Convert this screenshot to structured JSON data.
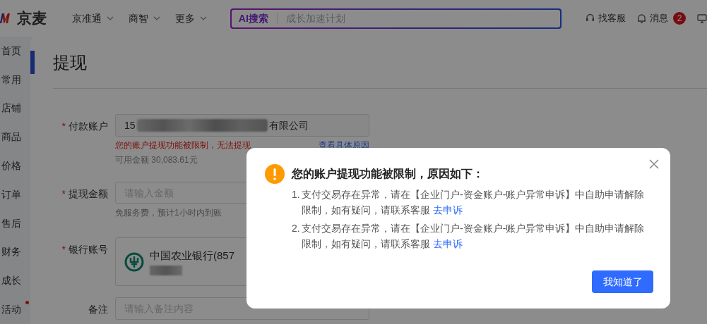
{
  "header": {
    "logo_text": "京麦",
    "nav": [
      {
        "label": "京准通"
      },
      {
        "label": "商智"
      },
      {
        "label": "更多"
      }
    ],
    "search": {
      "ai_label": "AI搜索",
      "placeholder": "成长加速计划"
    },
    "actions": [
      {
        "kind": "support",
        "label": "找客服"
      },
      {
        "kind": "messages",
        "label": "消息",
        "badge": "2"
      },
      {
        "kind": "screen"
      }
    ]
  },
  "sidebar": {
    "items": [
      {
        "label": "首页",
        "dot": false
      },
      {
        "label": "常用",
        "dot": false
      },
      {
        "label": "店铺",
        "dot": false
      },
      {
        "label": "商品",
        "dot": false
      },
      {
        "label": "价格",
        "dot": false
      },
      {
        "label": "订单",
        "dot": false
      },
      {
        "label": "售后",
        "dot": false
      },
      {
        "label": "财务",
        "dot": false
      },
      {
        "label": "成长",
        "dot": false
      },
      {
        "label": "活动",
        "dot": true
      }
    ]
  },
  "page": {
    "title": "提现"
  },
  "form": {
    "fields": [
      {
        "kind": "account",
        "label": "付款账户",
        "required_mark": "*",
        "value_start": "15",
        "value_end": "有限公司",
        "error": "您的账户提现功能被限制，无法提现",
        "link": "查看具体原因",
        "hint": "可用金额 30,083.61元"
      },
      {
        "kind": "input",
        "label": "提现金额",
        "required_mark": "*",
        "placeholder": "请输入金额",
        "hint": "免服务费，预计1小时内到账"
      },
      {
        "kind": "bank",
        "label": "银行账号",
        "required_mark": "*",
        "bank_name": "中国农业银行(857"
      },
      {
        "kind": "textarea",
        "label": "备注",
        "placeholder": "请输入备注内容"
      }
    ]
  },
  "dialog": {
    "title": "您的账户提现功能被限制，原因如下：",
    "items": [
      {
        "number": "1.",
        "text": "支付交易存在异常，请在【企业门户-资金账户-账户异常申诉】中自助申请解除限制，如有疑问，请联系客服",
        "link": "去申诉"
      },
      {
        "number": "2.",
        "text": "支付交易存在异常，请在【企业门户-资金账户-账户异常申诉】中自助申请解除限制，如有疑问，请联系客服",
        "link": "去申诉"
      }
    ],
    "button": "我知道了"
  }
}
